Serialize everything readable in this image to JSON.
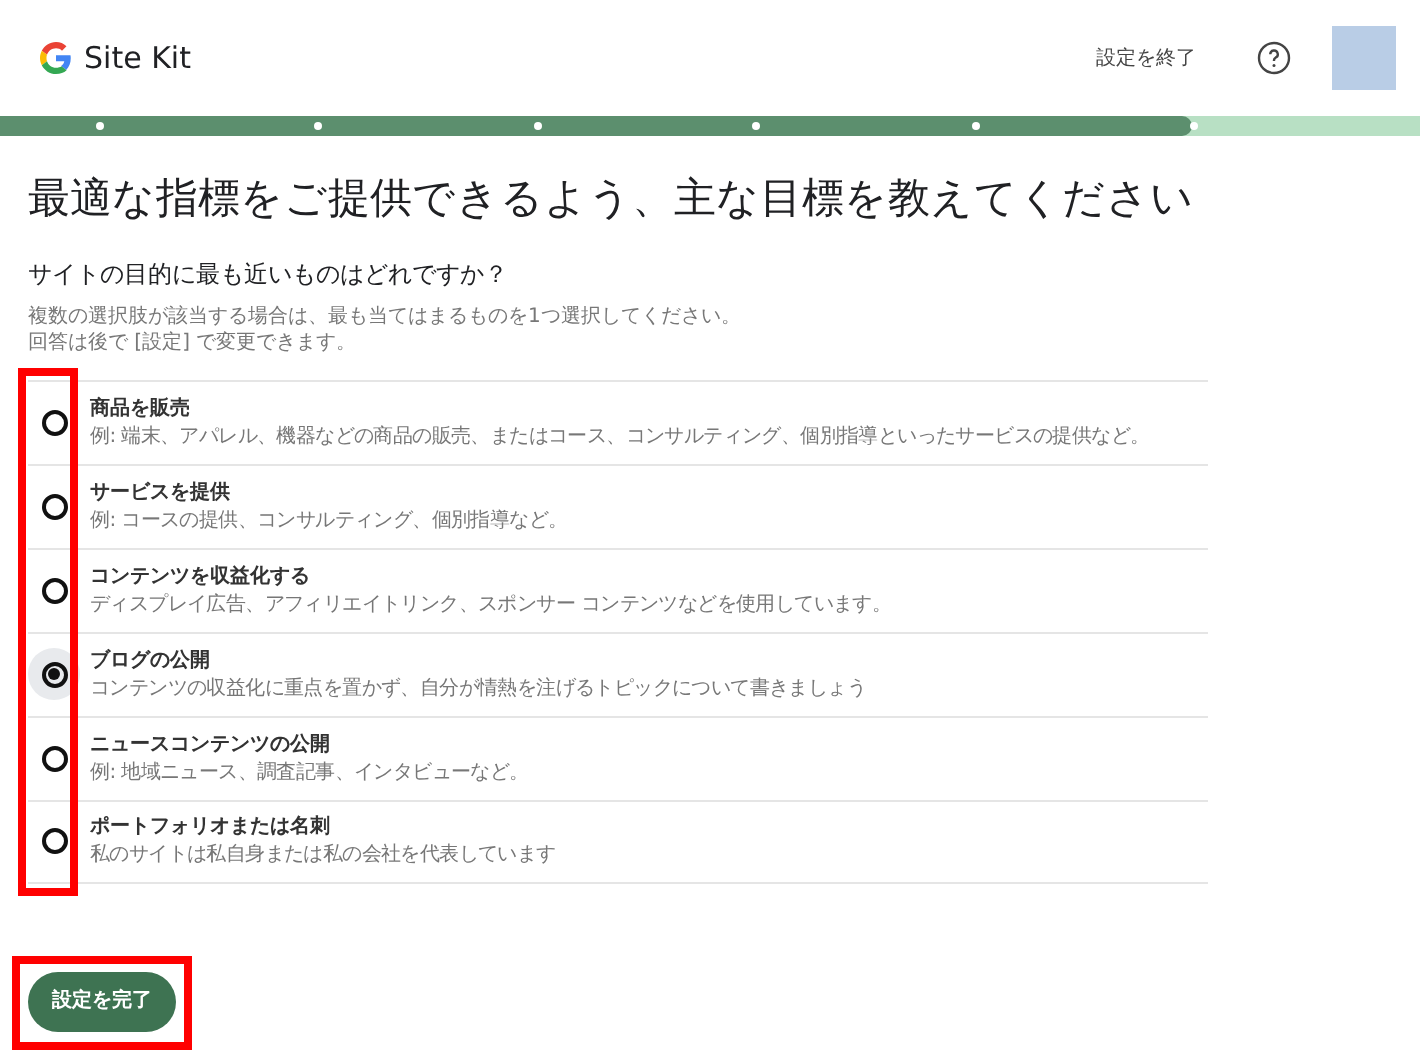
{
  "header": {
    "logo_text": "Site Kit",
    "exit_link": "設定を終了"
  },
  "progress": {
    "level": 0.84
  },
  "title": "最適な指標をご提供できるよう、主な目標を教えてください",
  "question": "サイトの目的に最も近いものはどれですか？",
  "help_lines": [
    "複数の選択肢が該当する場合は、最も当てはまるものを1つ選択してください。",
    "回答は後で [設定] で変更できます。"
  ],
  "options": [
    {
      "label": "商品を販売",
      "description": "例: 端末、アパレル、機器などの商品の販売、またはコース、コンサルティング、個別指導といったサービスの提供など。",
      "selected": false
    },
    {
      "label": "サービスを提供",
      "description": "例: コースの提供、コンサルティング、個別指導など。",
      "selected": false
    },
    {
      "label": "コンテンツを収益化する",
      "description": "ディスプレイ広告、アフィリエイトリンク、スポンサー コンテンツなどを使用しています。",
      "selected": false
    },
    {
      "label": "ブログの公開",
      "description": "コンテンツの収益化に重点を置かず、自分が情熱を注げるトピックについて書きましょう",
      "selected": true
    },
    {
      "label": "ニュースコンテンツの公開",
      "description": "例: 地域ニュース、調査記事、インタビューなど。",
      "selected": false
    },
    {
      "label": "ポートフォリオまたは名刺",
      "description": "私のサイトは私自身または私の会社を代表しています",
      "selected": false
    }
  ],
  "submit_button": "設定を完了"
}
